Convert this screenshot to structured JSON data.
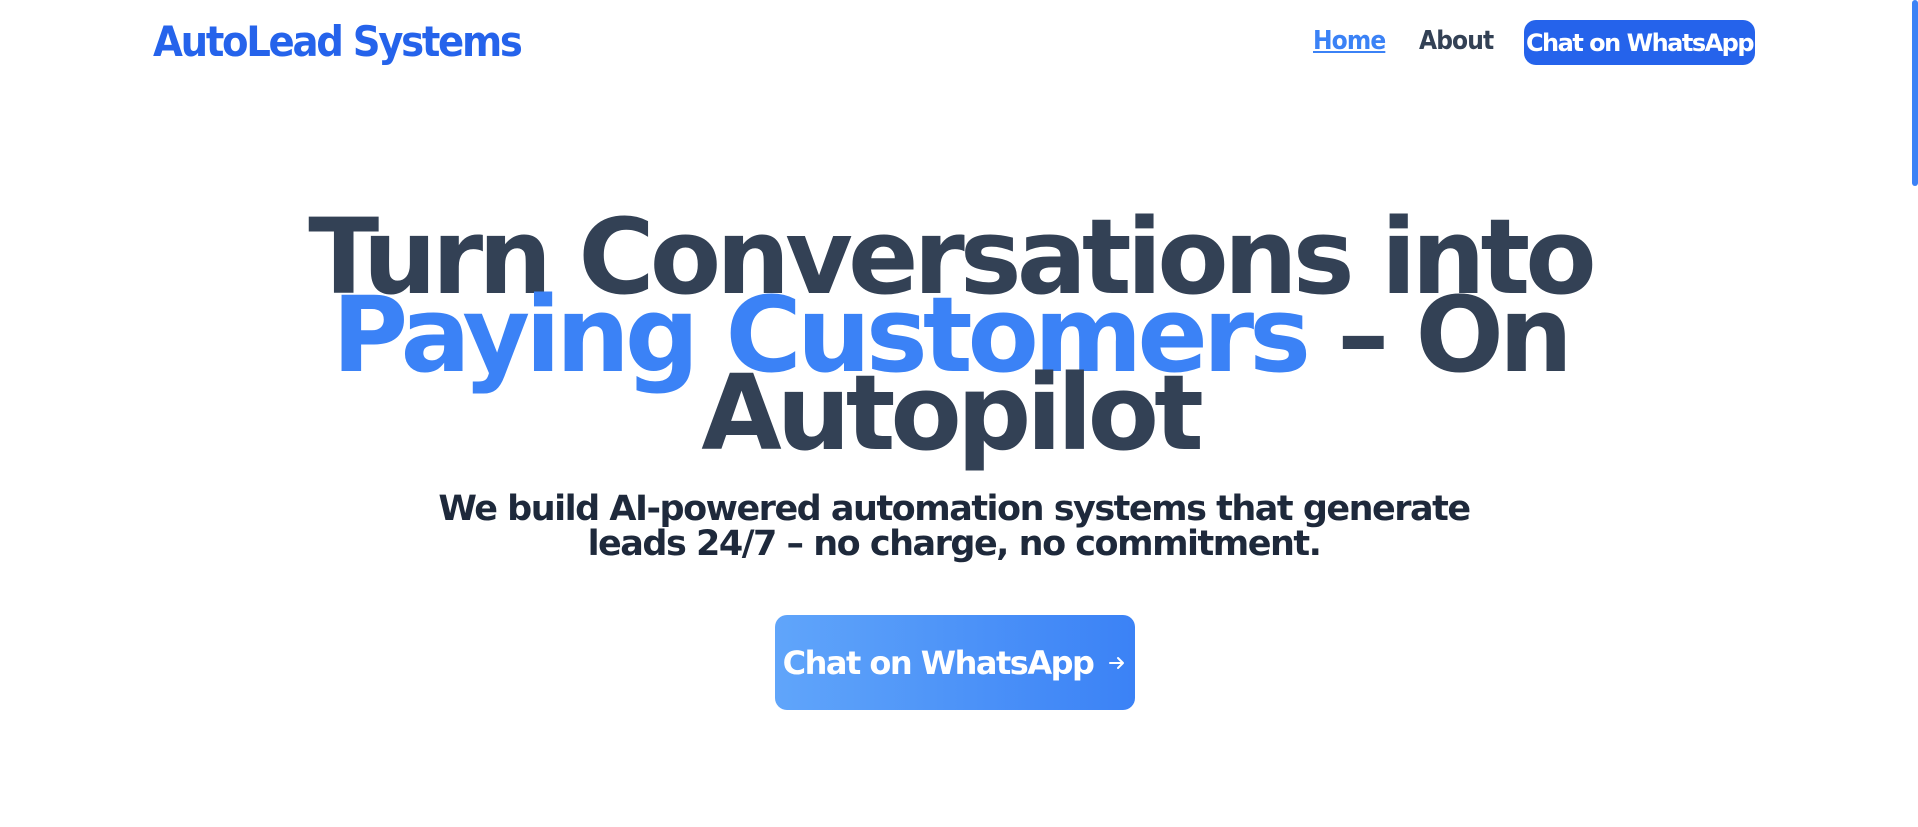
{
  "header": {
    "logo": "AutoLead Systems",
    "nav": {
      "home": "Home",
      "about": "About"
    },
    "cta_label": "Chat on WhatsApp"
  },
  "hero": {
    "title_line1": "Turn Conversations into",
    "title_line2_accent": "Paying Customers",
    "title_line2_rest": " – On",
    "title_line3": "Autopilot",
    "subtitle_line1": "We build AI-powered automation systems that generate",
    "subtitle_line2": "leads 24/7 – no charge, no commitment.",
    "cta_label": "Chat on WhatsApp",
    "cta_icon": "arrow-right-icon"
  },
  "colors": {
    "brand": "#2563eb",
    "accent": "#3b82f6",
    "heading": "#334155",
    "text": "#1e293b"
  }
}
